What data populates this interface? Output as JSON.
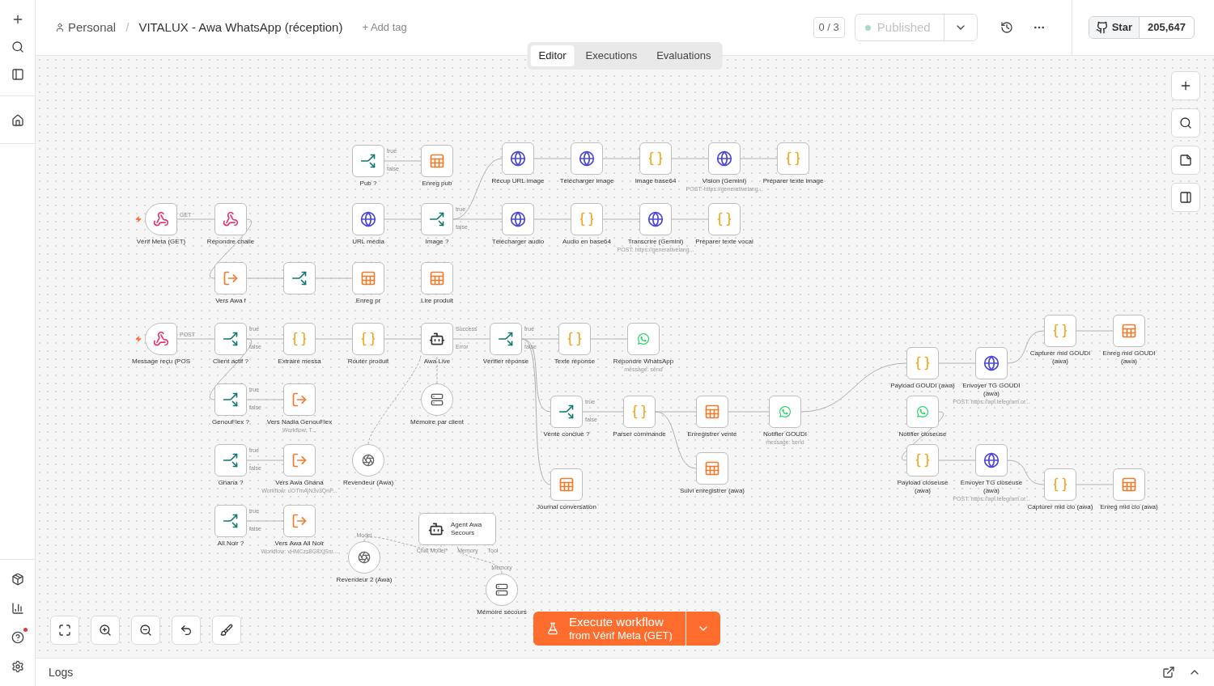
{
  "header": {
    "owner": "Personal",
    "separator": "/",
    "title": "VITALUX - Awa WhatsApp (réception)",
    "add_tag": "+ Add tag",
    "counter": "0 / 3",
    "publish": {
      "label": "Published",
      "disabled": true
    },
    "github": {
      "label": "Star",
      "count": "205,647"
    }
  },
  "tabs": [
    {
      "label": "Editor",
      "selected": true
    },
    {
      "label": "Executions",
      "selected": false
    },
    {
      "label": "Evaluations",
      "selected": false
    }
  ],
  "sidebar": {
    "help_badge": true
  },
  "nodes": [
    {
      "label": "Vérif Meta (GET)",
      "kind": "webhook",
      "trigger": true,
      "outputs": [
        "GET"
      ]
    },
    {
      "label": "Répondre challe",
      "kind": "webhook",
      "trigger": false
    },
    {
      "label": "Pub ?",
      "kind": "if",
      "outputs": [
        "true",
        "false"
      ]
    },
    {
      "label": "URL média",
      "kind": "http"
    },
    {
      "label": "Enreg pub",
      "kind": "sheet"
    },
    {
      "label": "Récup URL image",
      "kind": "http"
    },
    {
      "label": "Télécharger image",
      "kind": "http"
    },
    {
      "label": "Image base64",
      "kind": "code"
    },
    {
      "label": "Vision (Gemini)",
      "kind": "http",
      "subtitle": "POST: https://generativelang..."
    },
    {
      "label": "Préparer texte image",
      "kind": "code"
    },
    {
      "label": "Télécharger audio",
      "kind": "http"
    },
    {
      "label": "Audio en base64",
      "kind": "code"
    },
    {
      "label": "Transcrire (Gemini)",
      "kind": "http",
      "subtitle": "POST: https://generativelang..."
    },
    {
      "label": "Préparer texte vocal",
      "kind": "code"
    },
    {
      "label": "Vers Awa f",
      "kind": "exec"
    },
    {
      "kind": "if"
    },
    {
      "label": "Enreg pr",
      "kind": "sheet"
    },
    {
      "label": "Image ?",
      "kind": "if",
      "outputs": [
        "true",
        "false"
      ]
    },
    {
      "label": "Lire produit",
      "kind": "sheet"
    },
    {
      "label": "Message reçu (POS",
      "kind": "webhook",
      "trigger": true,
      "outputs": [
        "POST"
      ]
    },
    {
      "label": "Client actif ?",
      "kind": "if",
      "outputs": [
        "true",
        "false"
      ]
    },
    {
      "label": "Extraire messa",
      "kind": "code"
    },
    {
      "label": "Router produit",
      "kind": "code"
    },
    {
      "label": "Awa Live",
      "kind": "agent",
      "outputs": [
        "Success",
        "Error"
      ]
    },
    {
      "label": "Vérifier réponse",
      "kind": "if",
      "outputs": [
        "true",
        "false"
      ]
    },
    {
      "label": "Texte réponse",
      "kind": "code"
    },
    {
      "label": "Répondre WhatsApp",
      "kind": "whatsapp",
      "subtitle": "message: send"
    },
    {
      "label": "GenouFlex ?",
      "kind": "if",
      "outputs": [
        "true",
        "false"
      ]
    },
    {
      "label": "Vers Nadia GenouFlex",
      "kind": "exec",
      "subtitle": "Workflow: T..."
    },
    {
      "label": "Ghana ?",
      "kind": "if",
      "outputs": [
        "true",
        "false"
      ]
    },
    {
      "label": "Vers Awa Ghana",
      "kind": "exec",
      "subtitle": "Workflow: uOTmAjN3v3QnP..."
    },
    {
      "label": "Revendeur (Awa)",
      "kind": "model"
    },
    {
      "label": "Mémoire par client",
      "kind": "memory"
    },
    {
      "label": "All Noir ?",
      "kind": "if",
      "outputs": [
        "true",
        "false"
      ]
    },
    {
      "label": "Vers Awa All Noir",
      "kind": "exec",
      "subtitle": "Workflow: vHMCzs8G8XjSm..."
    },
    {
      "label": "Vente conclue ?",
      "kind": "if",
      "outputs": [
        "true",
        "false"
      ]
    },
    {
      "label": "Parser commande",
      "kind": "code"
    },
    {
      "label": "Enregistrer vente",
      "kind": "sheet"
    },
    {
      "label": "Notifier GOUDI",
      "kind": "whatsapp",
      "subtitle": "message: send"
    },
    {
      "label": "Suivi enregistrer (awa)",
      "kind": "sheet"
    },
    {
      "label": "Journal conversation",
      "kind": "sheet"
    },
    {
      "label": "Payload GOUDI (awa)",
      "kind": "code"
    },
    {
      "label": "Notifier closeuse",
      "kind": "whatsapp"
    },
    {
      "label": "Envoyer TG GOUDI (awa)",
      "kind": "http",
      "subtitle": "POST: https://api.telegram.or..."
    },
    {
      "label": "Capturer mid GOUDI (awa)",
      "kind": "code"
    },
    {
      "label": "Enreg mid GOUDI (awa)",
      "kind": "sheet"
    },
    {
      "label": "Payload closeuse (awa)",
      "kind": "code"
    },
    {
      "label": "Envoyer TG closeuse (awa)",
      "kind": "http",
      "subtitle": "POST: https://api.telegram.or..."
    },
    {
      "label": "Capturer mid clo (awa)",
      "kind": "code"
    },
    {
      "label": "Enreg mid clo (awa)",
      "kind": "sheet"
    },
    {
      "label": "Agent Awa Secours",
      "kind": "agent",
      "ports": [
        "Chat Model*",
        "Memory",
        "Tool"
      ]
    },
    {
      "label": "Revendeur 2 (Awa)",
      "kind": "model",
      "port": "Model"
    },
    {
      "label": "Mémoire secours",
      "kind": "memory",
      "port": "Memory"
    }
  ],
  "execute": {
    "label": "Execute workflow",
    "sub": "from Vérif Meta (GET)"
  },
  "logs": {
    "label": "Logs"
  }
}
